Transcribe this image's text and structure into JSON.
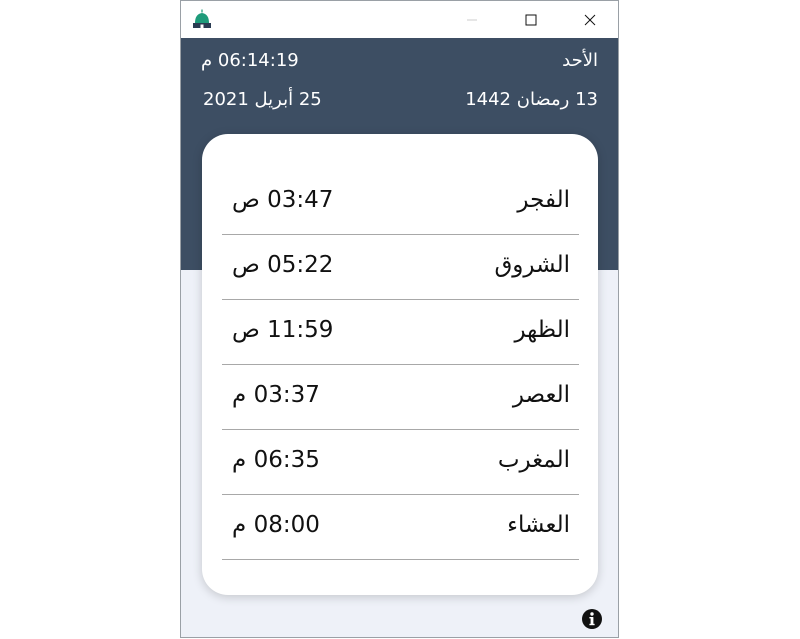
{
  "window": {
    "app_icon": "mosque-icon",
    "controls": {
      "minimize": "minimize-icon",
      "maximize": "maximize-icon",
      "close": "close-icon"
    }
  },
  "header": {
    "day_name": "الأحد",
    "current_time": "06:14:19 م",
    "hijri_date": "13 رمضان 1442",
    "gregorian_date": "25 أبريل 2021"
  },
  "prayers": [
    {
      "name": "الفجر",
      "time": "03:47 ص"
    },
    {
      "name": "الشروق",
      "time": "05:22 ص"
    },
    {
      "name": "الظهر",
      "time": "11:59 ص"
    },
    {
      "name": "العصر",
      "time": "03:37 م"
    },
    {
      "name": "المغرب",
      "time": "06:35 م"
    },
    {
      "name": "العشاء",
      "time": "08:00 م"
    }
  ],
  "footer": {
    "info_icon": "info-icon"
  },
  "colors": {
    "header_bg": "#3d4e63",
    "body_bg": "#eef1f8",
    "card_bg": "#ffffff",
    "mosque_dome": "#1e9b7a"
  }
}
